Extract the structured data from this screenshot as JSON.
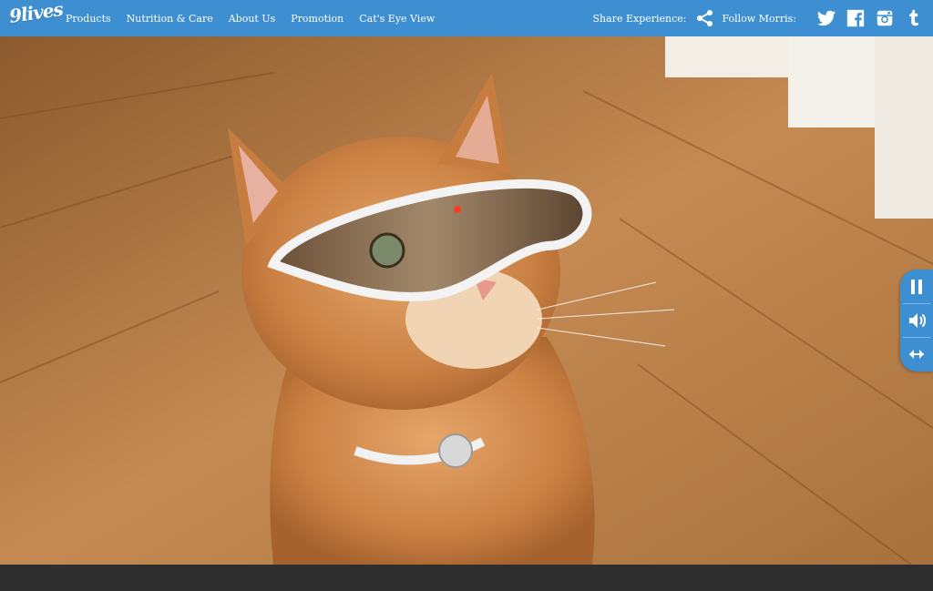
{
  "brand": {
    "logo_text": "9lives",
    "accent": "#3d8fd1"
  },
  "nav": {
    "items": [
      "Products",
      "Nutrition & Care",
      "About Us",
      "Promotion",
      "Cat's Eye View"
    ]
  },
  "header_right": {
    "share_label": "Share Experience:",
    "share_icon": "share-icon",
    "follow_label": "Follow Morris:",
    "social_icons": [
      "twitter-icon",
      "facebook-icon",
      "instagram-icon",
      "tumblr-icon"
    ]
  },
  "video": {
    "controls": [
      "pause-icon",
      "volume-icon",
      "expand-icon"
    ]
  }
}
